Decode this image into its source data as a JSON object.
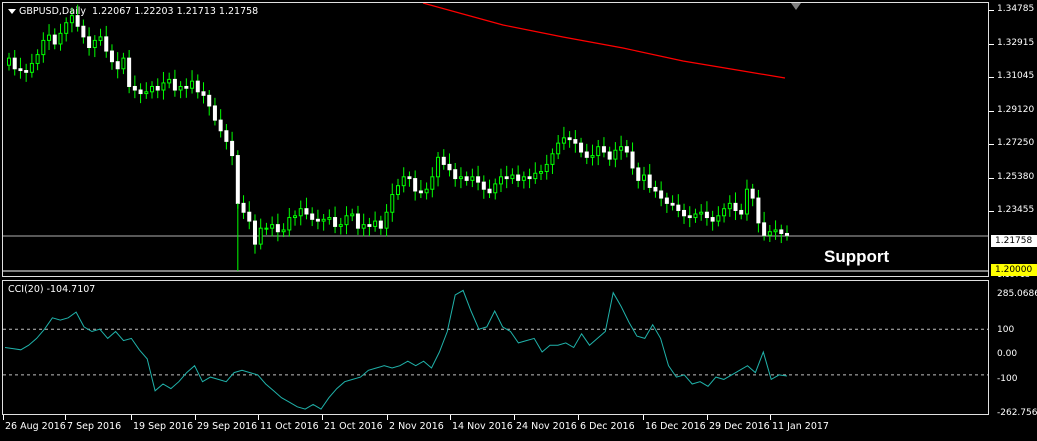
{
  "chart_title": "GBPUSD,Daily",
  "ohlc_header": "1.22067 1.22203 1.21713 1.21758",
  "dropdown_icon": "triangle-down",
  "annotation": "Support",
  "current_price_tag": "1.21758",
  "support_price_tag": "1.20000",
  "partial_label": "1.19713",
  "indicator_title": "CCI(20) -104.7107",
  "colors": {
    "background": "#000000",
    "bull_candle": "#00ff00",
    "bear_candle": "#ffffff",
    "moving_average": "#ff0000",
    "cci_line": "#20b2aa",
    "support_line": "#ffffff",
    "tag_current_bg": "#ffffff",
    "tag_support_bg": "#ffff00"
  },
  "chart_data": [
    {
      "type": "candlestick",
      "title": "GBPUSD,Daily",
      "y_ticks": [
        "1.34785",
        "1.32915",
        "1.31045",
        "1.29120",
        "1.27250",
        "1.25380",
        "1.23455",
        "1.21758",
        "1.20000"
      ],
      "ylim": [
        1.195,
        1.348
      ],
      "x_ticks": [
        "26 Aug 2016",
        "7 Sep 2016",
        "19 Sep 2016",
        "29 Sep 2016",
        "11 Oct 2016",
        "21 Oct 2016",
        "2 Nov 2016",
        "14 Nov 2016",
        "24 Nov 2016",
        "6 Dec 2016",
        "16 Dec 2016",
        "29 Dec 2016",
        "11 Jan 2017"
      ],
      "support_level": 1.2,
      "current_price": 1.21758,
      "closes": [
        1.318,
        1.312,
        1.311,
        1.31,
        1.315,
        1.32,
        1.328,
        1.331,
        1.326,
        1.332,
        1.338,
        1.342,
        1.336,
        1.33,
        1.324,
        1.328,
        1.33,
        1.322,
        1.316,
        1.312,
        1.318,
        1.302,
        1.3,
        1.298,
        1.299,
        1.302,
        1.3,
        1.304,
        1.306,
        1.3,
        1.302,
        1.301,
        1.305,
        1.299,
        1.297,
        1.291,
        1.283,
        1.277,
        1.271,
        1.263,
        1.236,
        1.231,
        1.226,
        1.213,
        1.222,
        1.222,
        1.224,
        1.22,
        1.221,
        1.228,
        1.229,
        1.233,
        1.23,
        1.227,
        1.226,
        1.227,
        1.228,
        1.223,
        1.224,
        1.229,
        1.23,
        1.222,
        1.224,
        1.223,
        1.226,
        1.222,
        1.231,
        1.241,
        1.246,
        1.251,
        1.25,
        1.243,
        1.242,
        1.244,
        1.251,
        1.262,
        1.258,
        1.255,
        1.25,
        1.251,
        1.249,
        1.251,
        1.248,
        1.244,
        1.242,
        1.247,
        1.251,
        1.25,
        1.252,
        1.249,
        1.251,
        1.25,
        1.253,
        1.254,
        1.258,
        1.264,
        1.27,
        1.273,
        1.272,
        1.27,
        1.265,
        1.262,
        1.263,
        1.268,
        1.265,
        1.261,
        1.266,
        1.268,
        1.265,
        1.256,
        1.249,
        1.252,
        1.245,
        1.243,
        1.239,
        1.236,
        1.235,
        1.232,
        1.229,
        1.228,
        1.23,
        1.231,
        1.228,
        1.226,
        1.229,
        1.233,
        1.236,
        1.232,
        1.23,
        1.244,
        1.239,
        1.225,
        1.218,
        1.22,
        1.221,
        1.219,
        1.218
      ]
    },
    {
      "type": "line",
      "title": "CCI(20) -104.7107",
      "y_ticks": [
        "285.0686",
        "100",
        "0.00",
        "-100",
        "-262.7568"
      ],
      "ylim": [
        -262.7568,
        285.0686
      ],
      "reference_levels": [
        100,
        -100
      ],
      "values": [
        20,
        15,
        10,
        30,
        60,
        100,
        150,
        140,
        150,
        175,
        110,
        90,
        100,
        60,
        90,
        50,
        60,
        10,
        -30,
        -170,
        -140,
        -160,
        -130,
        -90,
        -60,
        -130,
        -110,
        -120,
        -130,
        -90,
        -80,
        -90,
        -100,
        -140,
        -170,
        -200,
        -220,
        -240,
        -250,
        -230,
        -250,
        -200,
        -160,
        -130,
        -120,
        -110,
        -80,
        -70,
        -60,
        -70,
        -60,
        -40,
        -60,
        -40,
        -70,
        0,
        90,
        250,
        270,
        180,
        100,
        110,
        180,
        110,
        90,
        40,
        50,
        60,
        0,
        30,
        30,
        40,
        20,
        80,
        30,
        60,
        90,
        260,
        200,
        130,
        70,
        60,
        120,
        60,
        -60,
        -110,
        -100,
        -140,
        -130,
        -150,
        -110,
        -120,
        -100,
        -80,
        -60,
        -90,
        0,
        -120,
        -100,
        -105
      ]
    }
  ]
}
